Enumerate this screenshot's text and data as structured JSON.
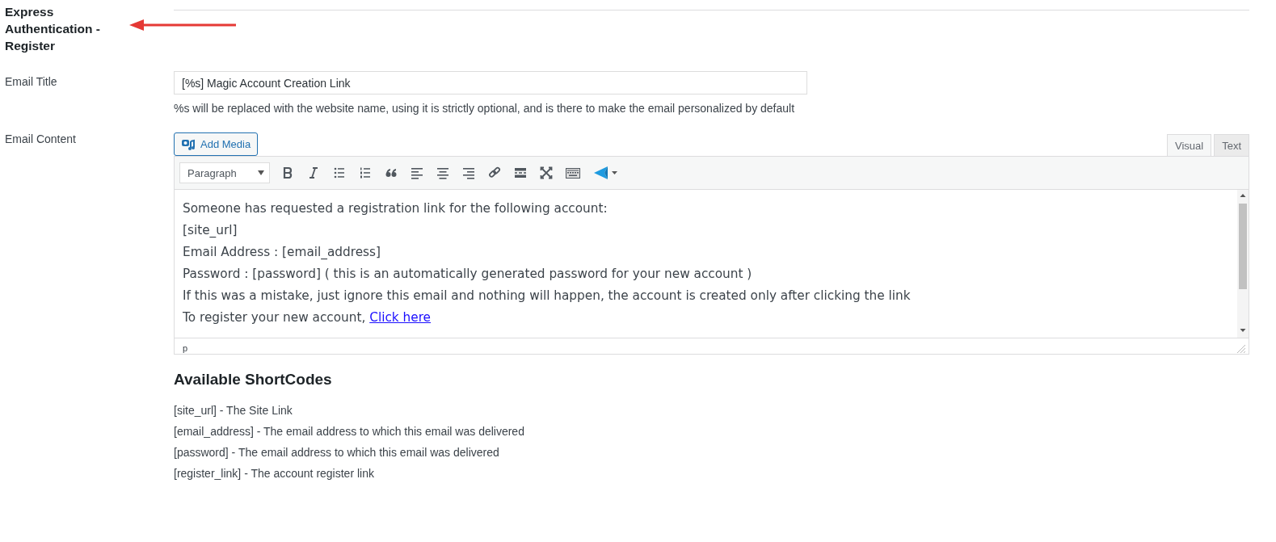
{
  "section_title": "Express Authentication - Register",
  "fields": [
    {
      "label": "Email Title",
      "value": "[%s] Magic Account Creation Link",
      "help": "%s will be replaced with the website name, using it is strictly optional, and is there to make the email personalized by default"
    }
  ],
  "editor": {
    "label": "Email Content",
    "add_media": "Add Media",
    "tabs": [
      {
        "label": "Visual",
        "selected": true
      },
      {
        "label": "Text",
        "selected": false
      }
    ],
    "format": "Paragraph",
    "lines": [
      {
        "text": "Someone has requested a registration link for the following account:"
      },
      {
        "text": "[site_url]"
      },
      {
        "text": "Email Address : [email_address]"
      },
      {
        "text": "Password : [password] ( this is an automatically generated password for your new account )"
      },
      {
        "text": "If this was a mistake, just ignore this email and nothing will happen, the account is created only after clicking the link"
      },
      {
        "text": "To register your new account, ",
        "link": "Click here"
      }
    ],
    "path": "p"
  },
  "shortcodes": {
    "title": "Available ShortCodes",
    "items": [
      "[site_url] - The Site Link",
      "[email_address] - The email address to which this email was delivered",
      "[password] - The email address to which this email was delivered",
      "[register_link] - The account register link"
    ]
  }
}
